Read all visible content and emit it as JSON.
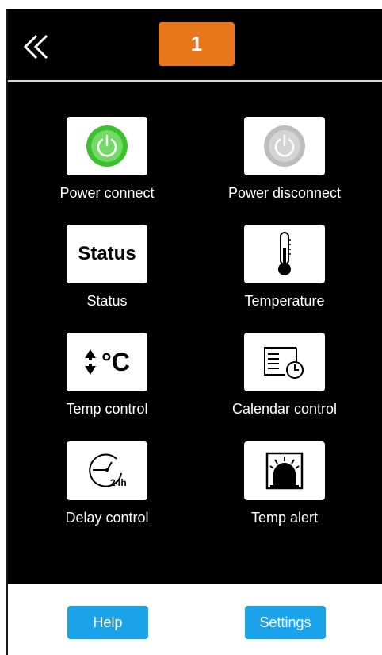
{
  "header": {
    "back_icon": "double-chevron-left-icon",
    "device_number": "1"
  },
  "tiles": [
    {
      "label": "Power connect",
      "icon": "power-on-icon"
    },
    {
      "label": "Power disconnect",
      "icon": "power-off-icon"
    },
    {
      "label": "Status",
      "icon_text": "Status",
      "icon": "status-icon"
    },
    {
      "label": "Temperature",
      "icon": "thermometer-icon"
    },
    {
      "label": "Temp control",
      "icon_text": "°C",
      "icon": "temp-control-icon"
    },
    {
      "label": "Calendar control",
      "icon": "calendar-clock-icon"
    },
    {
      "label": "Delay control",
      "icon_text": "24h",
      "icon": "delay-24h-icon"
    },
    {
      "label": "Temp alert",
      "icon": "alarm-light-icon"
    }
  ],
  "footer": {
    "help_label": "Help",
    "settings_label": "Settings"
  },
  "colors": {
    "background": "#000000",
    "badge": "#e8761b",
    "button": "#1aa3e8",
    "power_on": "#3cc12e",
    "power_off": "#bdbdbd"
  }
}
